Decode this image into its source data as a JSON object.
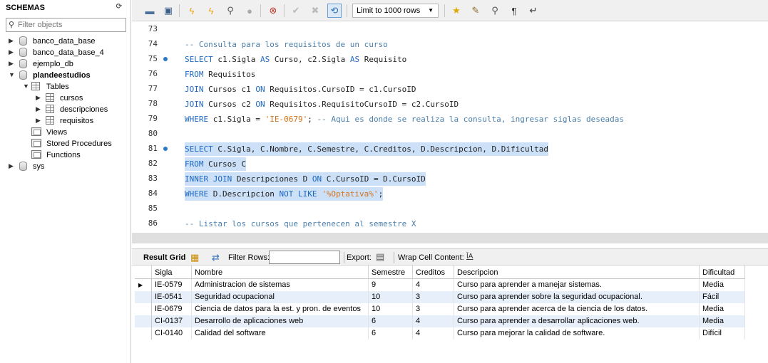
{
  "sidebar": {
    "title": "SCHEMAS",
    "filter_placeholder": "Filter objects",
    "schemas": [
      {
        "name": "banco_data_base"
      },
      {
        "name": "banco_data_base_4"
      },
      {
        "name": "ejemplo_db"
      },
      {
        "name": "plandeestudios"
      }
    ],
    "tables_label": "Tables",
    "tables": [
      "cursos",
      "descripciones",
      "requisitos"
    ],
    "views_label": "Views",
    "procedures_label": "Stored Procedures",
    "functions_label": "Functions",
    "last_schema": "sys"
  },
  "toolbar": {
    "limit_label": "Limit to 1000 rows"
  },
  "editor": {
    "lines": [
      {
        "n": "73",
        "text": ""
      },
      {
        "n": "74",
        "text": "-- Consulta para los requisitos de un curso"
      },
      {
        "n": "75",
        "text": "SELECT c1.Sigla AS Curso, c2.Sigla AS Requisito"
      },
      {
        "n": "76",
        "text": "FROM Requisitos"
      },
      {
        "n": "77",
        "text": "JOIN Cursos c1 ON Requisitos.CursoID = c1.CursoID"
      },
      {
        "n": "78",
        "text": "JOIN Cursos c2 ON Requisitos.RequisitoCursoID = c2.CursoID"
      },
      {
        "n": "79",
        "text": "WHERE c1.Sigla = 'IE-0679'; -- Aqui es donde se realiza la consulta, ingresar siglas deseadas"
      },
      {
        "n": "80",
        "text": ""
      },
      {
        "n": "81",
        "text": "SELECT C.Sigla, C.Nombre, C.Semestre, C.Creditos, D.Descripcion, D.Dificultad"
      },
      {
        "n": "82",
        "text": "FROM Cursos C"
      },
      {
        "n": "83",
        "text": "INNER JOIN Descripciones D ON C.CursoID = D.CursoID"
      },
      {
        "n": "84",
        "text": "WHERE D.Descripcion NOT LIKE '%Optativa%';"
      },
      {
        "n": "85",
        "text": ""
      },
      {
        "n": "86",
        "text": "-- Listar los cursos que pertenecen al semestre X"
      }
    ]
  },
  "results": {
    "result_grid_label": "Result Grid",
    "filter_rows_label": "Filter Rows:",
    "export_label": "Export:",
    "wrap_label": "Wrap Cell Content:",
    "columns": [
      "Sigla",
      "Nombre",
      "Semestre",
      "Creditos",
      "Descripcion",
      "Dificultad"
    ],
    "rows": [
      [
        "IE-0579",
        "Administracion de sistemas",
        "9",
        "4",
        "Curso para aprender a manejar sistemas.",
        "Media"
      ],
      [
        "IE-0541",
        "Seguridad ocupacional",
        "10",
        "3",
        "Curso para aprender sobre la seguridad ocupacional.",
        "Fácil"
      ],
      [
        "IE-0679",
        "Ciencia de datos para la est. y pron. de eventos",
        "10",
        "3",
        "Curso para aprender acerca de la ciencia de los datos.",
        "Media"
      ],
      [
        "CI-0137",
        "Desarrollo de aplicaciones web",
        "6",
        "4",
        "Curso para aprender a desarrollar aplicaciones web.",
        "Media"
      ],
      [
        "CI-0140",
        "Calidad del software",
        "6",
        "4",
        "Curso para mejorar la calidad de software.",
        "Difícil"
      ]
    ]
  }
}
